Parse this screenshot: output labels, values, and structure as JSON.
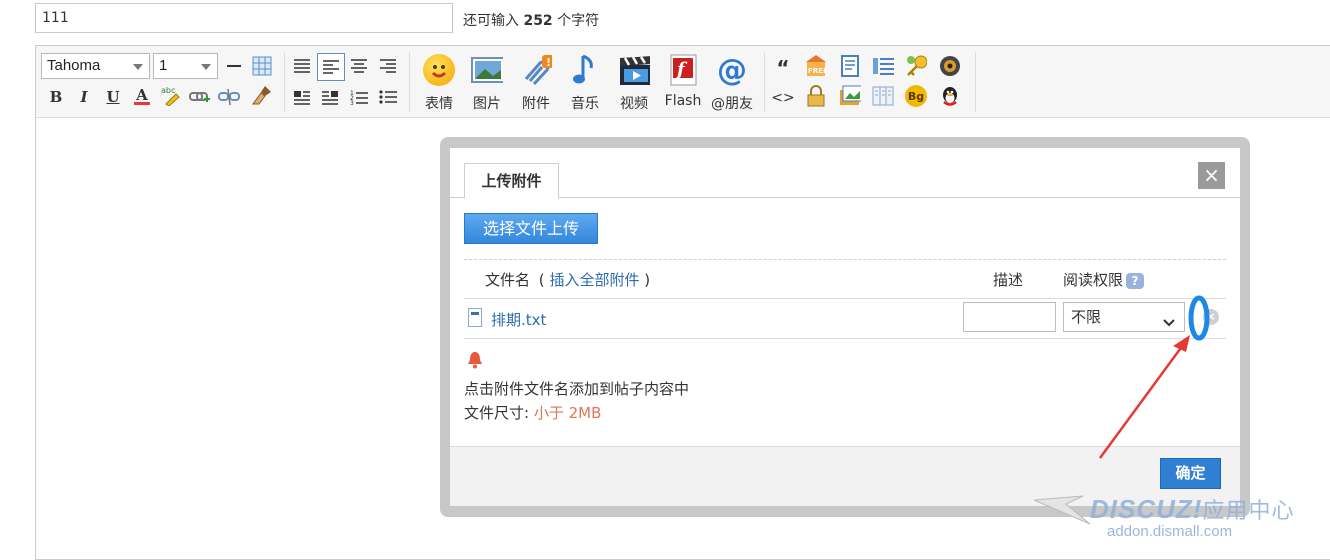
{
  "title_input": {
    "value": "111"
  },
  "char_hint": {
    "prefix": "还可输入",
    "count": "252",
    "suffix": "个字符"
  },
  "toolbar": {
    "font_family": "Tahoma",
    "font_size": "1",
    "format_buttons": {
      "bold": "B",
      "italic": "I",
      "underline": "U",
      "color": "A"
    },
    "big_buttons": {
      "emoji": "表情",
      "image": "图片",
      "attachment": "附件",
      "music": "音乐",
      "video": "视频",
      "flash": "Flash",
      "mention": "@朋友"
    },
    "small_glyphs": {
      "quote": "“",
      "code": "<>",
      "bg": "Bg"
    },
    "icons": {
      "emoji": "smiley-icon",
      "image": "image-icon",
      "attachment": "paperclip-icon",
      "music": "music-note-icon",
      "video": "clapperboard-icon",
      "flash": "flash-icon",
      "mention": "at-icon"
    }
  },
  "dialog": {
    "tab": "上传附件",
    "close": "×",
    "upload_button": "选择文件上传",
    "headers": {
      "filename": "文件名",
      "paren_open": "(",
      "insert_all": "插入全部附件",
      "paren_close": ")",
      "desc": "描述",
      "permission": "阅读权限",
      "help": "?"
    },
    "file": {
      "name": "排期.txt",
      "description": "",
      "permission": "不限",
      "permission_options": [
        "不限"
      ]
    },
    "note": "点击附件文件名添加到帖子内容中",
    "size_label": "文件尺寸: ",
    "size_value": "小于 2MB",
    "ok_button": "确定"
  },
  "watermark": {
    "logo": "DISCUZ!",
    "logo_cn": "应用中心",
    "url": "addon.dismall.com"
  },
  "colors": {
    "accent": "#2f7fd2",
    "link": "#2b6cb0",
    "annotation": "#e53935",
    "highlight_ring": "#1e88e5"
  }
}
